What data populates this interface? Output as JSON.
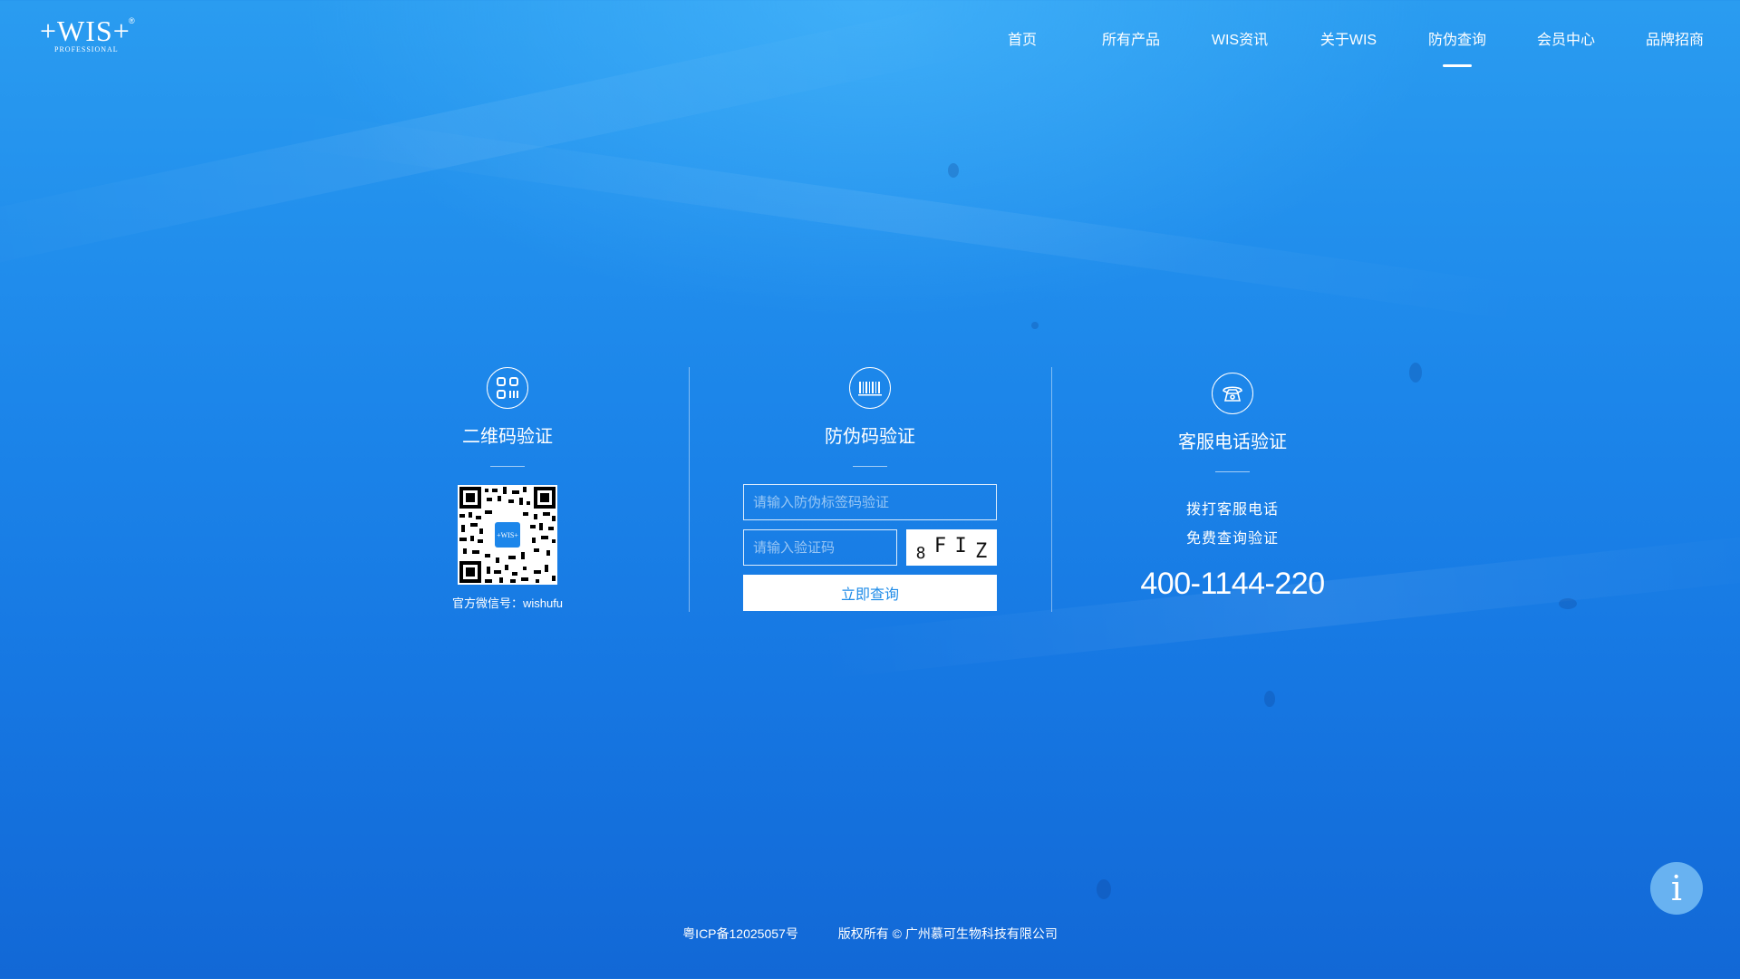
{
  "header": {
    "logo_text": "+WIS+",
    "logo_reg": "®",
    "logo_sub": "PROFESSIONAL",
    "nav": [
      {
        "label": "首页"
      },
      {
        "label": "所有产品"
      },
      {
        "label": "WIS资讯"
      },
      {
        "label": "关于WIS"
      },
      {
        "label": "防伪查询",
        "active": true
      },
      {
        "label": "会员中心"
      },
      {
        "label": "品牌招商"
      }
    ]
  },
  "qr_panel": {
    "icon": "qr-code-icon",
    "title": "二维码验证",
    "caption": "官方微信号：wishufu"
  },
  "code_panel": {
    "icon": "barcode-icon",
    "title": "防伪码验证",
    "code_placeholder": "请输入防伪标签码验证",
    "captcha_placeholder": "请输入验证码",
    "captcha_chars": [
      "8",
      "F",
      "I",
      "Z"
    ],
    "submit_label": "立即查询"
  },
  "phone_panel": {
    "icon": "telephone-icon",
    "title": "客服电话验证",
    "line1": "拨打客服电话",
    "line2": "免费查询验证",
    "phone": "400-1144-220"
  },
  "footer": {
    "icp": "粤ICP备12025057号",
    "copyright": "版权所有 © 广州慕可生物科技有限公司"
  },
  "floating": {
    "info_label": "i"
  },
  "colors": {
    "background": "#1c86ea",
    "button_text": "#1e8be8"
  }
}
